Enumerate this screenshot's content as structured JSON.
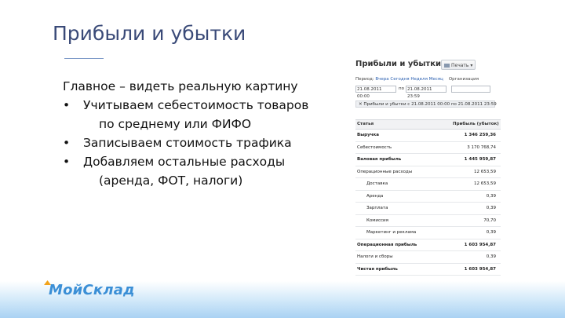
{
  "slide": {
    "title": "Прибыли и убытки",
    "lead": "Главное – видеть реальную картину",
    "bullets": [
      {
        "bullet": "•",
        "lines": [
          "Учитываем себестоимость товаров",
          "по среднему или ФИФО"
        ]
      },
      {
        "bullet": "•",
        "lines": [
          "Записываем стоимость трафика"
        ]
      },
      {
        "bullet": "•",
        "lines": [
          "Добавляем остальные расходы",
          "(аренда, ФОТ, налоги)"
        ]
      }
    ],
    "logo": "МойСклад"
  },
  "screenshot": {
    "title": "Прибыли и убытки",
    "print_label": "Печать",
    "filters": {
      "period_label": "Период",
      "period_links": [
        "Вчера",
        "Сегодня",
        "Неделя",
        "Месяц"
      ],
      "org_label": "Организация",
      "date_from": "21.08.2011 00:00",
      "to_label": "по",
      "date_to": "21.08.2011 23:59"
    },
    "chip": "Прибыли и убытки с 21.08.2011 00:00 по 21.08.2011 23:59",
    "table": {
      "col_item": "Статья",
      "col_value": "Прибыль (убыток)",
      "rows": [
        {
          "label": "Выручка",
          "value": "1 346 259,36",
          "bold": true,
          "sub": false
        },
        {
          "label": "Себестоимость",
          "value": "3 170 768,74",
          "bold": false,
          "sub": false
        },
        {
          "label": "Валовая прибыль",
          "value": "1 445 959,87",
          "bold": true,
          "sub": false
        },
        {
          "label": "Операционные расходы",
          "value": "12 653,59",
          "bold": false,
          "sub": false
        },
        {
          "label": "Доставка",
          "value": "12 653,59",
          "bold": false,
          "sub": true
        },
        {
          "label": "Аренда",
          "value": "0,39",
          "bold": false,
          "sub": true
        },
        {
          "label": "Зарплата",
          "value": "0,39",
          "bold": false,
          "sub": true
        },
        {
          "label": "Комиссия",
          "value": "70,70",
          "bold": false,
          "sub": true
        },
        {
          "label": "Маркетинг и реклама",
          "value": "0,39",
          "bold": false,
          "sub": true
        },
        {
          "label": "Операционная прибыль",
          "value": "1 603 954,87",
          "bold": true,
          "sub": false
        },
        {
          "label": "Налоги и сборы",
          "value": "0,39",
          "bold": false,
          "sub": false
        },
        {
          "label": "Чистая прибыль",
          "value": "1 603 954,87",
          "bold": true,
          "sub": false
        }
      ]
    }
  },
  "colors": {
    "title": "#3a4a78",
    "accent_rule": "#7f9cc9",
    "logo": "#3b8fd6",
    "footer_band": "#a9d2f3"
  }
}
